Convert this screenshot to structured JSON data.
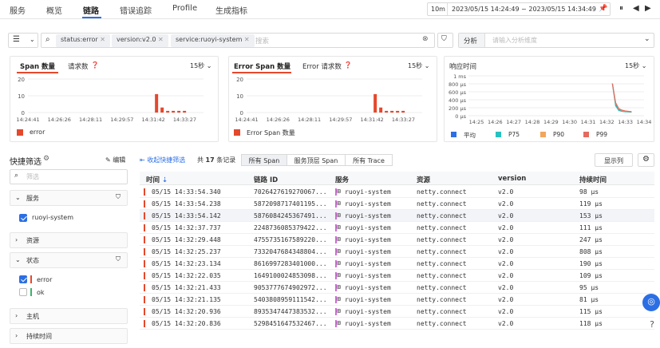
{
  "nav": {
    "tabs": [
      "服务",
      "概览",
      "链路",
      "错误追踪",
      "Profile",
      "生成指标"
    ],
    "active": "链路",
    "range_btn": "10m",
    "time_range": "2023/05/15 14:24:49 ~ 2023/05/15 14:34:49"
  },
  "filters": {
    "chips": [
      "status:error",
      "version:v2.0",
      "service:ruoyi-system"
    ],
    "search_placeholder": "搜索",
    "analyze_label": "分析",
    "analyze_placeholder": "请输入分析维度"
  },
  "chart1": {
    "tab_active": "Span 数量",
    "tab_other": "请求数",
    "interval": "15秒",
    "y_ticks": [
      "20",
      "10",
      "0"
    ],
    "x_ticks": [
      "14:24:41",
      "14:26:26",
      "14:28:11",
      "14:29:57",
      "14:31:42",
      "14:33:27"
    ],
    "legend": "error"
  },
  "chart2": {
    "tab_active": "Error Span 数量",
    "tab_other": "Error 请求数",
    "interval": "15秒",
    "y_ticks": [
      "20",
      "10",
      "0"
    ],
    "x_ticks": [
      "14:24:41",
      "14:26:26",
      "14:28:11",
      "14:29:57",
      "14:31:42",
      "14:33:27"
    ],
    "legend": "Error Span 数量"
  },
  "chart3": {
    "title": "响应时间",
    "interval": "15秒",
    "y_ticks": [
      "1 ms",
      "800 μs",
      "600 μs",
      "400 μs",
      "200 μs",
      "0 μs"
    ],
    "x_ticks": [
      "14:25",
      "14:26",
      "14:27",
      "14:28",
      "14:29",
      "14:30",
      "14:31",
      "14:32",
      "14:33",
      "14:34"
    ],
    "legend": [
      "平均",
      "P75",
      "P90",
      "P99"
    ]
  },
  "chart_data": [
    {
      "type": "bar",
      "title": "",
      "categories": [
        "14:31:42",
        "14:31:57",
        "14:32:12",
        "14:32:27",
        "14:32:42",
        "14:32:57"
      ],
      "series": [
        {
          "name": "error",
          "values": [
            11,
            3,
            1,
            1,
            1,
            1
          ]
        }
      ],
      "ylim": [
        0,
        20
      ]
    },
    {
      "type": "bar",
      "title": "",
      "categories": [
        "14:31:42",
        "14:31:57",
        "14:32:12",
        "14:32:27",
        "14:32:42",
        "14:32:57"
      ],
      "series": [
        {
          "name": "Error Span 数量",
          "values": [
            11,
            3,
            1,
            1,
            1,
            1
          ]
        }
      ],
      "ylim": [
        0,
        20
      ]
    },
    {
      "type": "line",
      "title": "响应时间",
      "x": [
        "14:32:00",
        "14:32:15",
        "14:32:30",
        "14:32:45",
        "14:33:00",
        "14:33:15",
        "14:33:30"
      ],
      "series": [
        {
          "name": "平均",
          "values": [
            808,
            300,
            150,
            120,
            110,
            100,
            95
          ]
        },
        {
          "name": "P75",
          "values": [
            808,
            250,
            130,
            110,
            100,
            95,
            90
          ]
        },
        {
          "name": "P90",
          "values": [
            808,
            320,
            170,
            130,
            115,
            105,
            100
          ]
        },
        {
          "name": "P99",
          "values": [
            808,
            330,
            180,
            140,
            120,
            110,
            100
          ]
        }
      ],
      "ylim": [
        0,
        1000
      ]
    }
  ],
  "left": {
    "title": "快捷筛选",
    "edit": "编辑",
    "search_placeholder": "筛选",
    "sections": {
      "service": "服务",
      "resource": "资源",
      "status": "状态",
      "host": "主机",
      "duration": "持续时间"
    },
    "service_opt": "ruoyi-system",
    "status_opts": [
      "error",
      "ok"
    ]
  },
  "toolbar": {
    "collapse": "收起快捷筛选",
    "total_prefix": "共",
    "total_count": "17",
    "total_suffix": "条记录",
    "seg": [
      "所有 Span",
      "服务顶层 Span",
      "所有 Trace"
    ],
    "display_col": "显示列"
  },
  "table": {
    "headers": [
      "时间",
      "链路 ID",
      "服务",
      "资源",
      "version",
      "持续时间"
    ],
    "rows": [
      [
        "05/15 14:33:54.340",
        "7026427619270067...",
        "ruoyi-system",
        "netty.connect",
        "v2.0",
        "98 μs"
      ],
      [
        "05/15 14:33:54.238",
        "5872098717401195...",
        "ruoyi-system",
        "netty.connect",
        "v2.0",
        "119 μs"
      ],
      [
        "05/15 14:33:54.142",
        "5876084245367491...",
        "ruoyi-system",
        "netty.connect",
        "v2.0",
        "153 μs"
      ],
      [
        "05/15 14:32:37.737",
        "2248736085379422...",
        "ruoyi-system",
        "netty.connect",
        "v2.0",
        "111 μs"
      ],
      [
        "05/15 14:32:29.448",
        "4755735167589220...",
        "ruoyi-system",
        "netty.connect",
        "v2.0",
        "247 μs"
      ],
      [
        "05/15 14:32:25.237",
        "7332047684348804...",
        "ruoyi-system",
        "netty.connect",
        "v2.0",
        "808 μs"
      ],
      [
        "05/15 14:32:23.134",
        "8616997283401000...",
        "ruoyi-system",
        "netty.connect",
        "v2.0",
        "190 μs"
      ],
      [
        "05/15 14:32:22.035",
        "1649100024853098...",
        "ruoyi-system",
        "netty.connect",
        "v2.0",
        "109 μs"
      ],
      [
        "05/15 14:32:21.433",
        "9053777674902972...",
        "ruoyi-system",
        "netty.connect",
        "v2.0",
        "95 μs"
      ],
      [
        "05/15 14:32:21.135",
        "5403808959111542...",
        "ruoyi-system",
        "netty.connect",
        "v2.0",
        "81 μs"
      ],
      [
        "05/15 14:32:20.936",
        "8935347447383532...",
        "ruoyi-system",
        "netty.connect",
        "v2.0",
        "115 μs"
      ],
      [
        "05/15 14:32:20.836",
        "5298451647532467...",
        "ruoyi-system",
        "netty.connect",
        "v2.0",
        "118 μs"
      ]
    ]
  },
  "colors": {
    "accent": "#2c6fe4",
    "error": "#e5482c",
    "avg": "#2c6fe4",
    "p75": "#27c2c0",
    "p90": "#f2a65a",
    "p99": "#e36b5f"
  }
}
